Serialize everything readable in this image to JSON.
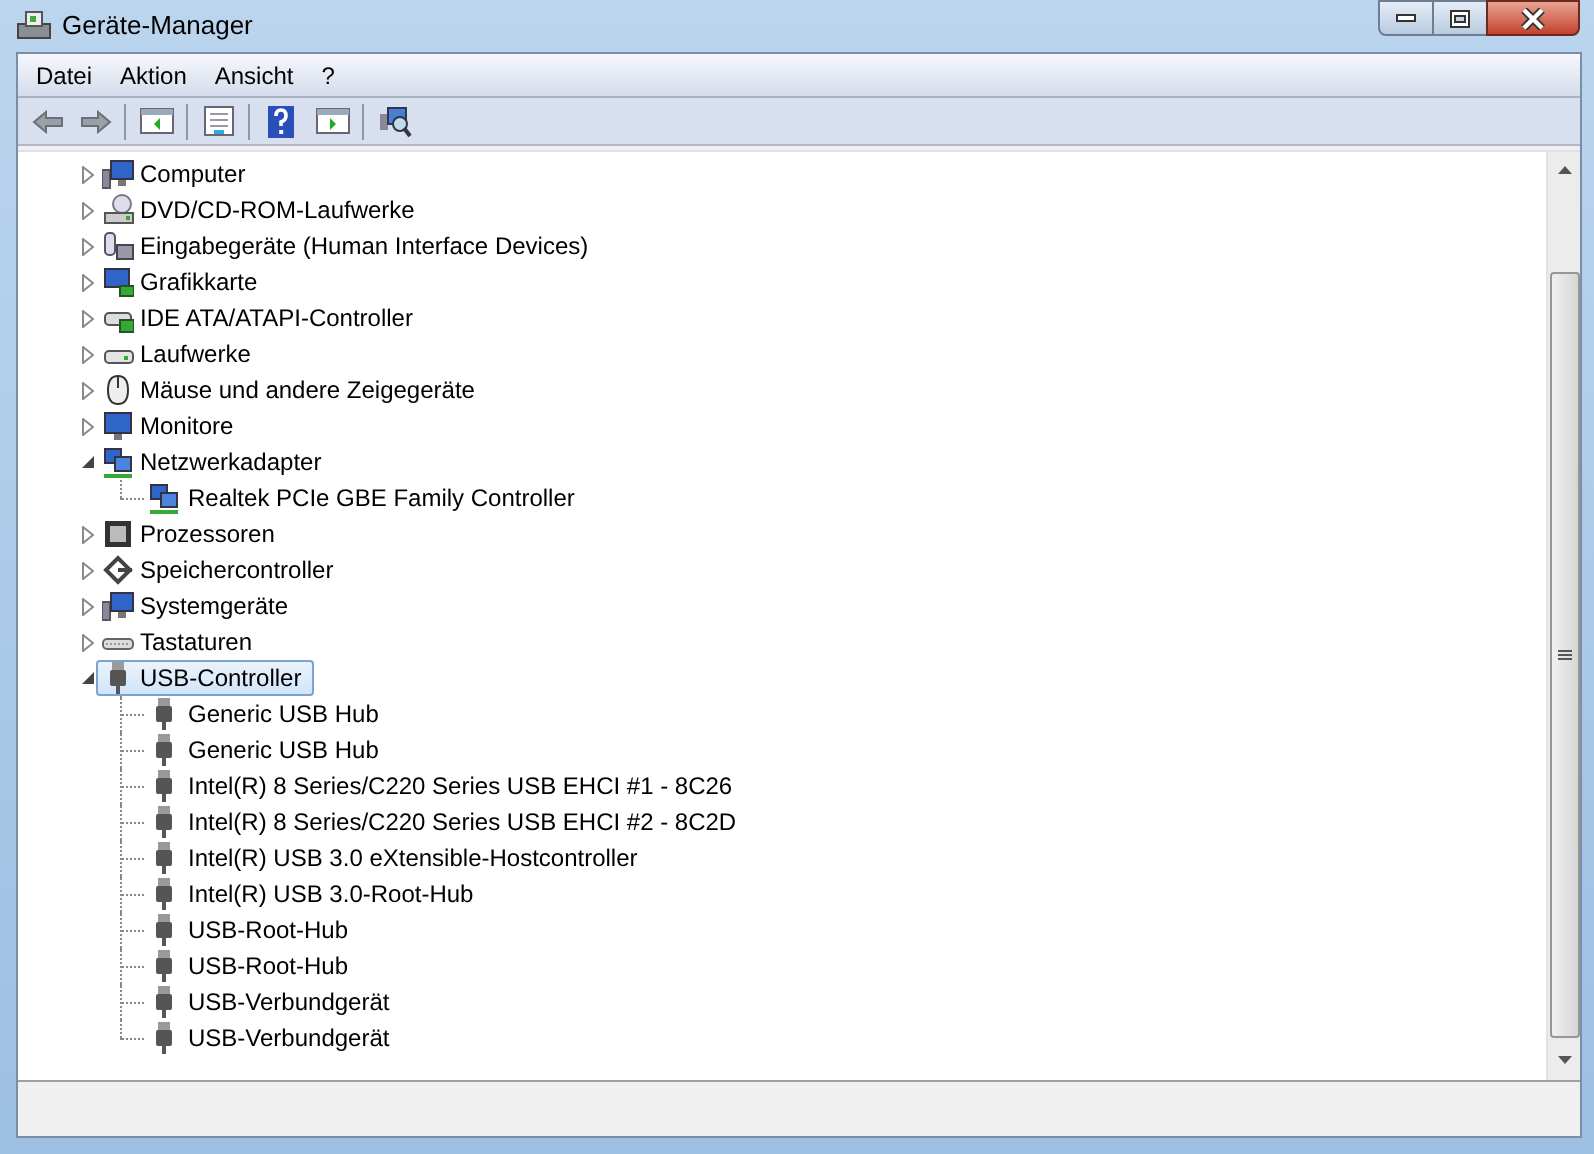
{
  "window": {
    "title": "Geräte-Manager"
  },
  "menu": [
    "Datei",
    "Aktion",
    "Ansicht",
    "?"
  ],
  "tree": [
    {
      "label": "Computer",
      "expanded": false,
      "selected": false
    },
    {
      "label": "DVD/CD-ROM-Laufwerke",
      "expanded": false,
      "selected": false
    },
    {
      "label": "Eingabegeräte (Human Interface Devices)",
      "expanded": false,
      "selected": false
    },
    {
      "label": "Grafikkarte",
      "expanded": false,
      "selected": false
    },
    {
      "label": "IDE ATA/ATAPI-Controller",
      "expanded": false,
      "selected": false
    },
    {
      "label": "Laufwerke",
      "expanded": false,
      "selected": false
    },
    {
      "label": "Mäuse und andere Zeigegeräte",
      "expanded": false,
      "selected": false
    },
    {
      "label": "Monitore",
      "expanded": false,
      "selected": false
    },
    {
      "label": "Netzwerkadapter",
      "expanded": true,
      "selected": false,
      "children": [
        {
          "label": "Realtek PCIe GBE Family Controller"
        }
      ]
    },
    {
      "label": "Prozessoren",
      "expanded": false,
      "selected": false
    },
    {
      "label": "Speichercontroller",
      "expanded": false,
      "selected": false
    },
    {
      "label": "Systemgeräte",
      "expanded": false,
      "selected": false
    },
    {
      "label": "Tastaturen",
      "expanded": false,
      "selected": false
    },
    {
      "label": "USB-Controller",
      "expanded": true,
      "selected": true,
      "children": [
        {
          "label": "Generic USB Hub"
        },
        {
          "label": "Generic USB Hub"
        },
        {
          "label": "Intel(R) 8 Series/C220 Series USB EHCI #1 - 8C26"
        },
        {
          "label": "Intel(R) 8 Series/C220 Series USB EHCI #2 - 8C2D"
        },
        {
          "label": "Intel(R) USB 3.0 eXtensible-Hostcontroller"
        },
        {
          "label": "Intel(R) USB 3.0-Root-Hub"
        },
        {
          "label": "USB-Root-Hub"
        },
        {
          "label": "USB-Root-Hub"
        },
        {
          "label": "USB-Verbundgerät"
        },
        {
          "label": "USB-Verbundgerät"
        }
      ]
    }
  ]
}
